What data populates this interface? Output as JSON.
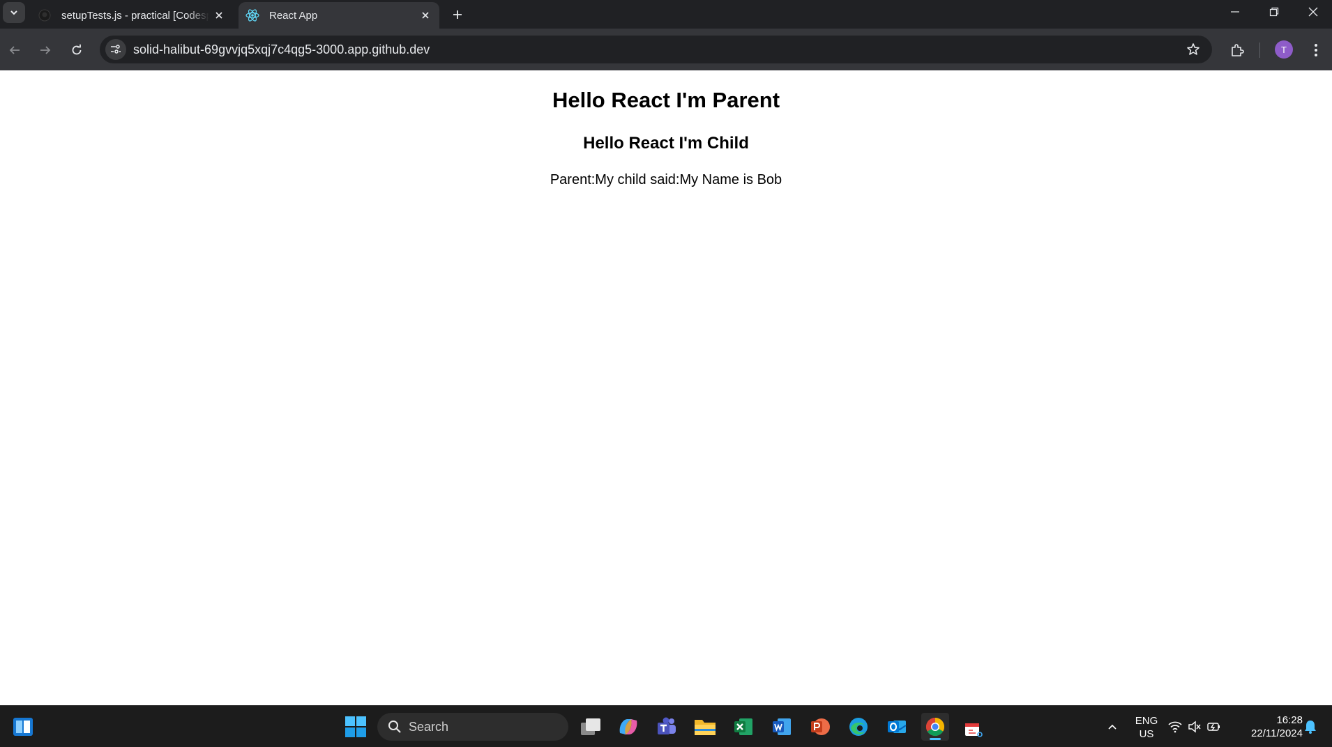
{
  "browser": {
    "tabs": [
      {
        "title": "setupTests.js - practical [Codespaces]",
        "favicon": "github-icon",
        "active": false
      },
      {
        "title": "React App",
        "favicon": "react-icon",
        "active": true
      }
    ],
    "url": "solid-halibut-69gvvjq5xqj7c4qg5-3000.app.github.dev",
    "profile_initial": "T",
    "colors": {
      "tabstrip": "#202124",
      "toolbar": "#35363a",
      "omnibox": "#202124",
      "avatar": "#8e5cc9"
    }
  },
  "page": {
    "parent_heading": "Hello React I'm Parent",
    "child_heading": "Hello React I'm Child",
    "message": "Parent:My child said:My Name is Bob"
  },
  "taskbar": {
    "search_label": "Search",
    "apps": [
      "task-view-icon",
      "copilot-icon",
      "teams-icon",
      "file-explorer-icon",
      "excel-icon",
      "word-icon",
      "powerpoint-icon",
      "edge-icon",
      "outlook-icon",
      "chrome-icon",
      "snipping-tool-icon"
    ],
    "language_line1": "ENG",
    "language_line2": "US",
    "time": "16:28",
    "date": "22/11/2024"
  }
}
